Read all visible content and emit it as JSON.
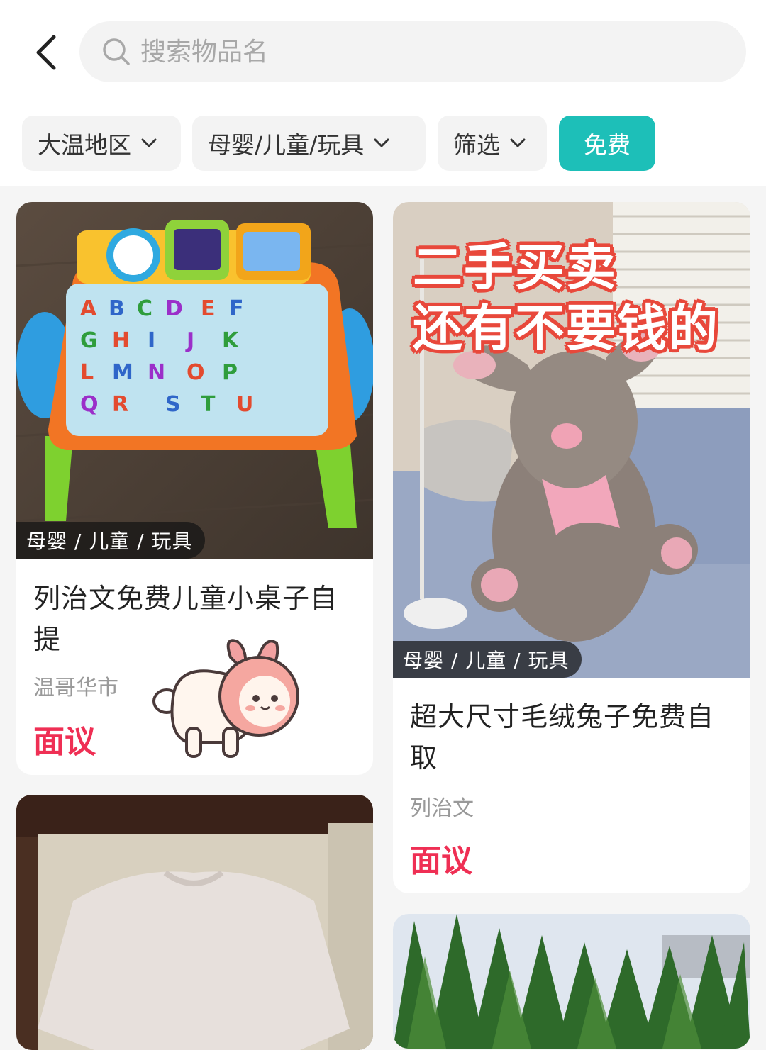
{
  "search": {
    "placeholder": "搜索物品名"
  },
  "filters": {
    "region": "大温地区",
    "category": "母婴/儿童/玩具",
    "filter": "筛选",
    "free": "免费"
  },
  "listings": [
    {
      "tag": "母婴 / 儿童 / 玩具",
      "title": "列治文免费儿童小桌子自提",
      "location": "温哥华市",
      "price": "面议"
    },
    {
      "tag": "母婴 / 儿童 / 玩具",
      "overlay_line1": "二手买卖",
      "overlay_line2": "还有不要钱的",
      "title": "超大尺寸毛绒兔子免费自取",
      "location": "列治文",
      "price": "面议"
    }
  ],
  "colors": {
    "accent": "#1dbfb8",
    "price": "#ef2f54"
  }
}
